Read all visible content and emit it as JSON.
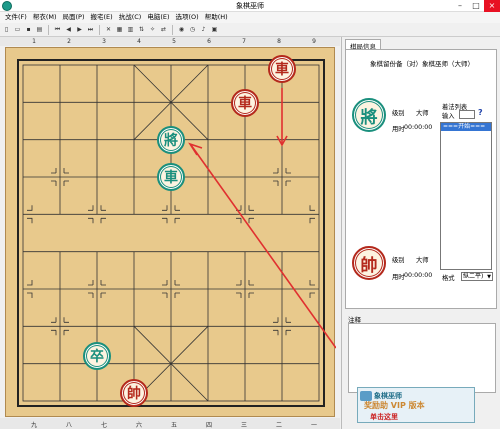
{
  "window": {
    "title": "象棋巫师"
  },
  "menu": [
    "文件(F)",
    "帮衣(M)",
    "局面(P)",
    "搬宅(E)",
    "抗战(C)",
    "电脑(E)",
    "选项(O)",
    "帮助(H)"
  ],
  "coords_top": [
    "1",
    "2",
    "3",
    "4",
    "5",
    "6",
    "7",
    "8",
    "9"
  ],
  "coords_bottom": [
    "九",
    "八",
    "七",
    "六",
    "五",
    "四",
    "三",
    "二",
    "一"
  ],
  "pieces": [
    {
      "char": "車",
      "side": "red",
      "col": 8,
      "row": 0
    },
    {
      "char": "車",
      "side": "red",
      "col": 7,
      "row": 1
    },
    {
      "char": "將",
      "side": "green",
      "col": 4,
      "row": 2
    },
    {
      "char": "車",
      "side": "green",
      "col": 4,
      "row": 3
    },
    {
      "char": "卒",
      "side": "green",
      "col": 2,
      "row": 8
    },
    {
      "char": "帥",
      "side": "red",
      "col": 3,
      "row": 9
    }
  ],
  "panel": {
    "tab_label": "棋局信息",
    "header": "象棋留份备（对）象棋巫师（大师）",
    "top_player": {
      "piece": "將",
      "side": "green",
      "level_label": "级别",
      "level_value": "大师",
      "time_label": "用时",
      "time_value": "00:00:00"
    },
    "bottom_player": {
      "piece": "帥",
      "side": "red",
      "level_label": "级别",
      "level_value": "大师",
      "time_label": "用时",
      "time_value": "00:00:00"
    },
    "movelist_title": "着法列表",
    "input_label": "输入",
    "help_label": "?",
    "movelist_items": [
      "===开始==="
    ],
    "format_label": "格式",
    "format_value": "纵二平)",
    "notes_label": "注释"
  },
  "banner": {
    "line1": "象棋巫师",
    "line2": "奖励助 VIP 版本",
    "line3": "单击这里"
  },
  "colors": {
    "red": "#b4291c",
    "green": "#1a8f7d",
    "board": "#e8c98c"
  }
}
